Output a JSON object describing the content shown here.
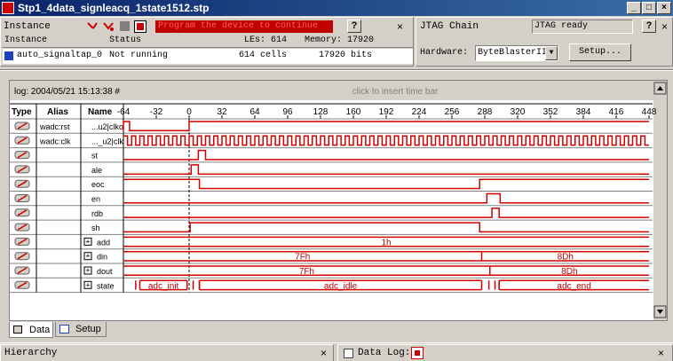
{
  "window": {
    "title": "Stp1_4data_signleacq_1state1512.stp"
  },
  "instance_panel": {
    "label": "Instance",
    "message": "Program the device to continue",
    "columns": {
      "instance": "Instance",
      "status": "Status",
      "les": "LEs: 614",
      "memory": "Memory: 17920"
    },
    "row": {
      "instance": "auto_signaltap_0",
      "status": "Not running",
      "les": "614 cells",
      "memory": "17920 bits"
    }
  },
  "jtag_panel": {
    "label": "JTAG Chain",
    "status": "JTAG ready",
    "hardware_label": "Hardware:",
    "hardware_value": "ByteBlasterII",
    "setup_label": "Setup..."
  },
  "waveform": {
    "log_label": "log: 2004/05/21 15:13:38 #",
    "time_bar_hint": "click to insert time bar",
    "headers": {
      "type": "Type",
      "alias": "Alias",
      "name": "Name"
    },
    "ticks": [
      "-64",
      "-32",
      "0",
      "32",
      "64",
      "96",
      "128",
      "160",
      "192",
      "224",
      "256",
      "288",
      "320",
      "352",
      "384",
      "416",
      "448"
    ],
    "signals": [
      {
        "alias": "wadc:rst",
        "name": "...u2|clko",
        "expand": ""
      },
      {
        "alias": "wadc:clk",
        "name": "..._u2|clk",
        "expand": ""
      },
      {
        "alias": "",
        "name": "st",
        "expand": ""
      },
      {
        "alias": "",
        "name": "ale",
        "expand": ""
      },
      {
        "alias": "",
        "name": "eoc",
        "expand": ""
      },
      {
        "alias": "",
        "name": "en",
        "expand": ""
      },
      {
        "alias": "",
        "name": "rdb",
        "expand": ""
      },
      {
        "alias": "",
        "name": "sh",
        "expand": ""
      },
      {
        "alias": "",
        "name": "add",
        "expand": "+"
      },
      {
        "alias": "",
        "name": "din",
        "expand": "+"
      },
      {
        "alias": "",
        "name": "dout",
        "expand": "+"
      },
      {
        "alias": "",
        "name": "state",
        "expand": "+"
      }
    ],
    "bus_values": {
      "add": [
        "1h"
      ],
      "din": [
        "7Fh",
        "8Dh"
      ],
      "dout": [
        "7Fh",
        "8Dh"
      ],
      "state": [
        "adc_init",
        "adc_idle",
        "adc_end"
      ]
    }
  },
  "chart_data": {
    "type": "line",
    "title": "",
    "x_unit": "samples",
    "xlim": [
      -64,
      448
    ],
    "trigger_at": 0,
    "digital_series": [
      {
        "name": "...u2|clko",
        "edges": [
          -64,
          -58,
          0
        ],
        "initial": 0
      },
      {
        "name": "..._u2|clk",
        "clock_period": 8,
        "initial": 1
      },
      {
        "name": "st",
        "edges": [
          9,
          16
        ],
        "initial": 0
      },
      {
        "name": "ale",
        "edges": [
          2,
          9
        ],
        "initial": 0
      },
      {
        "name": "eoc",
        "edges": [
          10,
          283
        ],
        "initial": 1
      },
      {
        "name": "en",
        "edges": [
          290,
          303
        ],
        "initial": 0
      },
      {
        "name": "rdb",
        "edges": [
          295,
          302
        ],
        "initial": 0
      },
      {
        "name": "sh",
        "edges": [
          1,
          283
        ],
        "initial": 0
      }
    ],
    "bus_series": [
      {
        "name": "add",
        "segments": [
          {
            "from": -64,
            "to": 448,
            "value": "1h"
          }
        ]
      },
      {
        "name": "din",
        "segments": [
          {
            "from": -64,
            "to": 285,
            "value": "7Fh"
          },
          {
            "from": 285,
            "to": 448,
            "value": "8Dh"
          }
        ]
      },
      {
        "name": "dout",
        "segments": [
          {
            "from": -64,
            "to": 293,
            "value": "7Fh"
          },
          {
            "from": 293,
            "to": 448,
            "value": "8Dh"
          }
        ]
      },
      {
        "name": "state",
        "segments": [
          {
            "from": -48,
            "to": -2,
            "value": "adc_init"
          },
          {
            "from": 10,
            "to": 285,
            "value": "adc_idle"
          },
          {
            "from": 302,
            "to": 448,
            "value": "adc_end"
          }
        ]
      }
    ]
  },
  "tabs": [
    {
      "label": "Data"
    },
    {
      "label": "Setup"
    }
  ],
  "bottom": {
    "hierarchy": "Hierarchy",
    "data_log": "Data Log:"
  }
}
